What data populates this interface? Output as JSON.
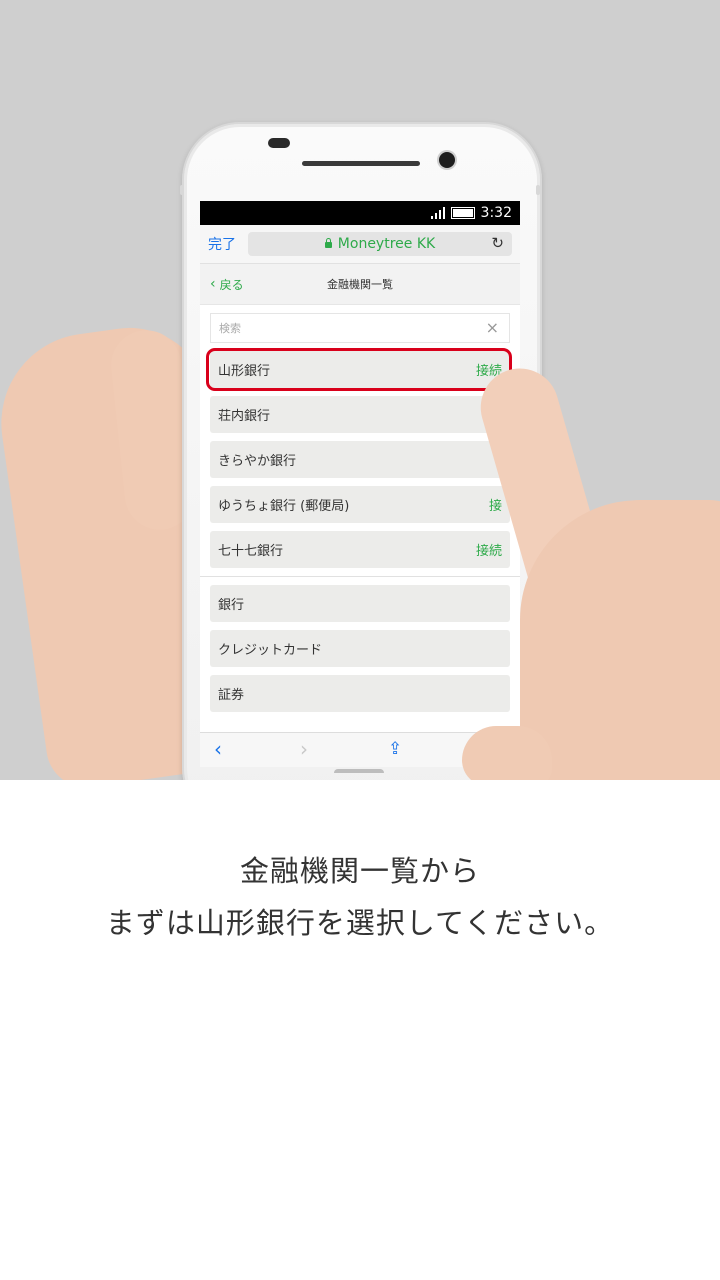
{
  "status_bar": {
    "time": "3:32"
  },
  "browser": {
    "done_label": "完了",
    "url_title": "Moneytree KK"
  },
  "nav": {
    "back_label": "戻る",
    "title": "金融機関一覧"
  },
  "search": {
    "placeholder": "検索"
  },
  "banks": [
    {
      "name": "山形銀行",
      "action": "接続"
    },
    {
      "name": "荘内銀行",
      "action": ""
    },
    {
      "name": "きらやか銀行",
      "action": ""
    },
    {
      "name": "ゆうちょ銀行 (郵便局)",
      "action": "接"
    },
    {
      "name": "七十七銀行",
      "action": "接続"
    }
  ],
  "categories": [
    {
      "name": "銀行"
    },
    {
      "name": "クレジットカード"
    },
    {
      "name": "証券"
    }
  ],
  "caption": {
    "line1": "金融機関一覧から",
    "line2": "まずは山形銀行を選択してください。"
  },
  "colors": {
    "accent_green": "#2eaa4a",
    "link_blue": "#1a73e8",
    "highlight_red": "#d9001b"
  }
}
